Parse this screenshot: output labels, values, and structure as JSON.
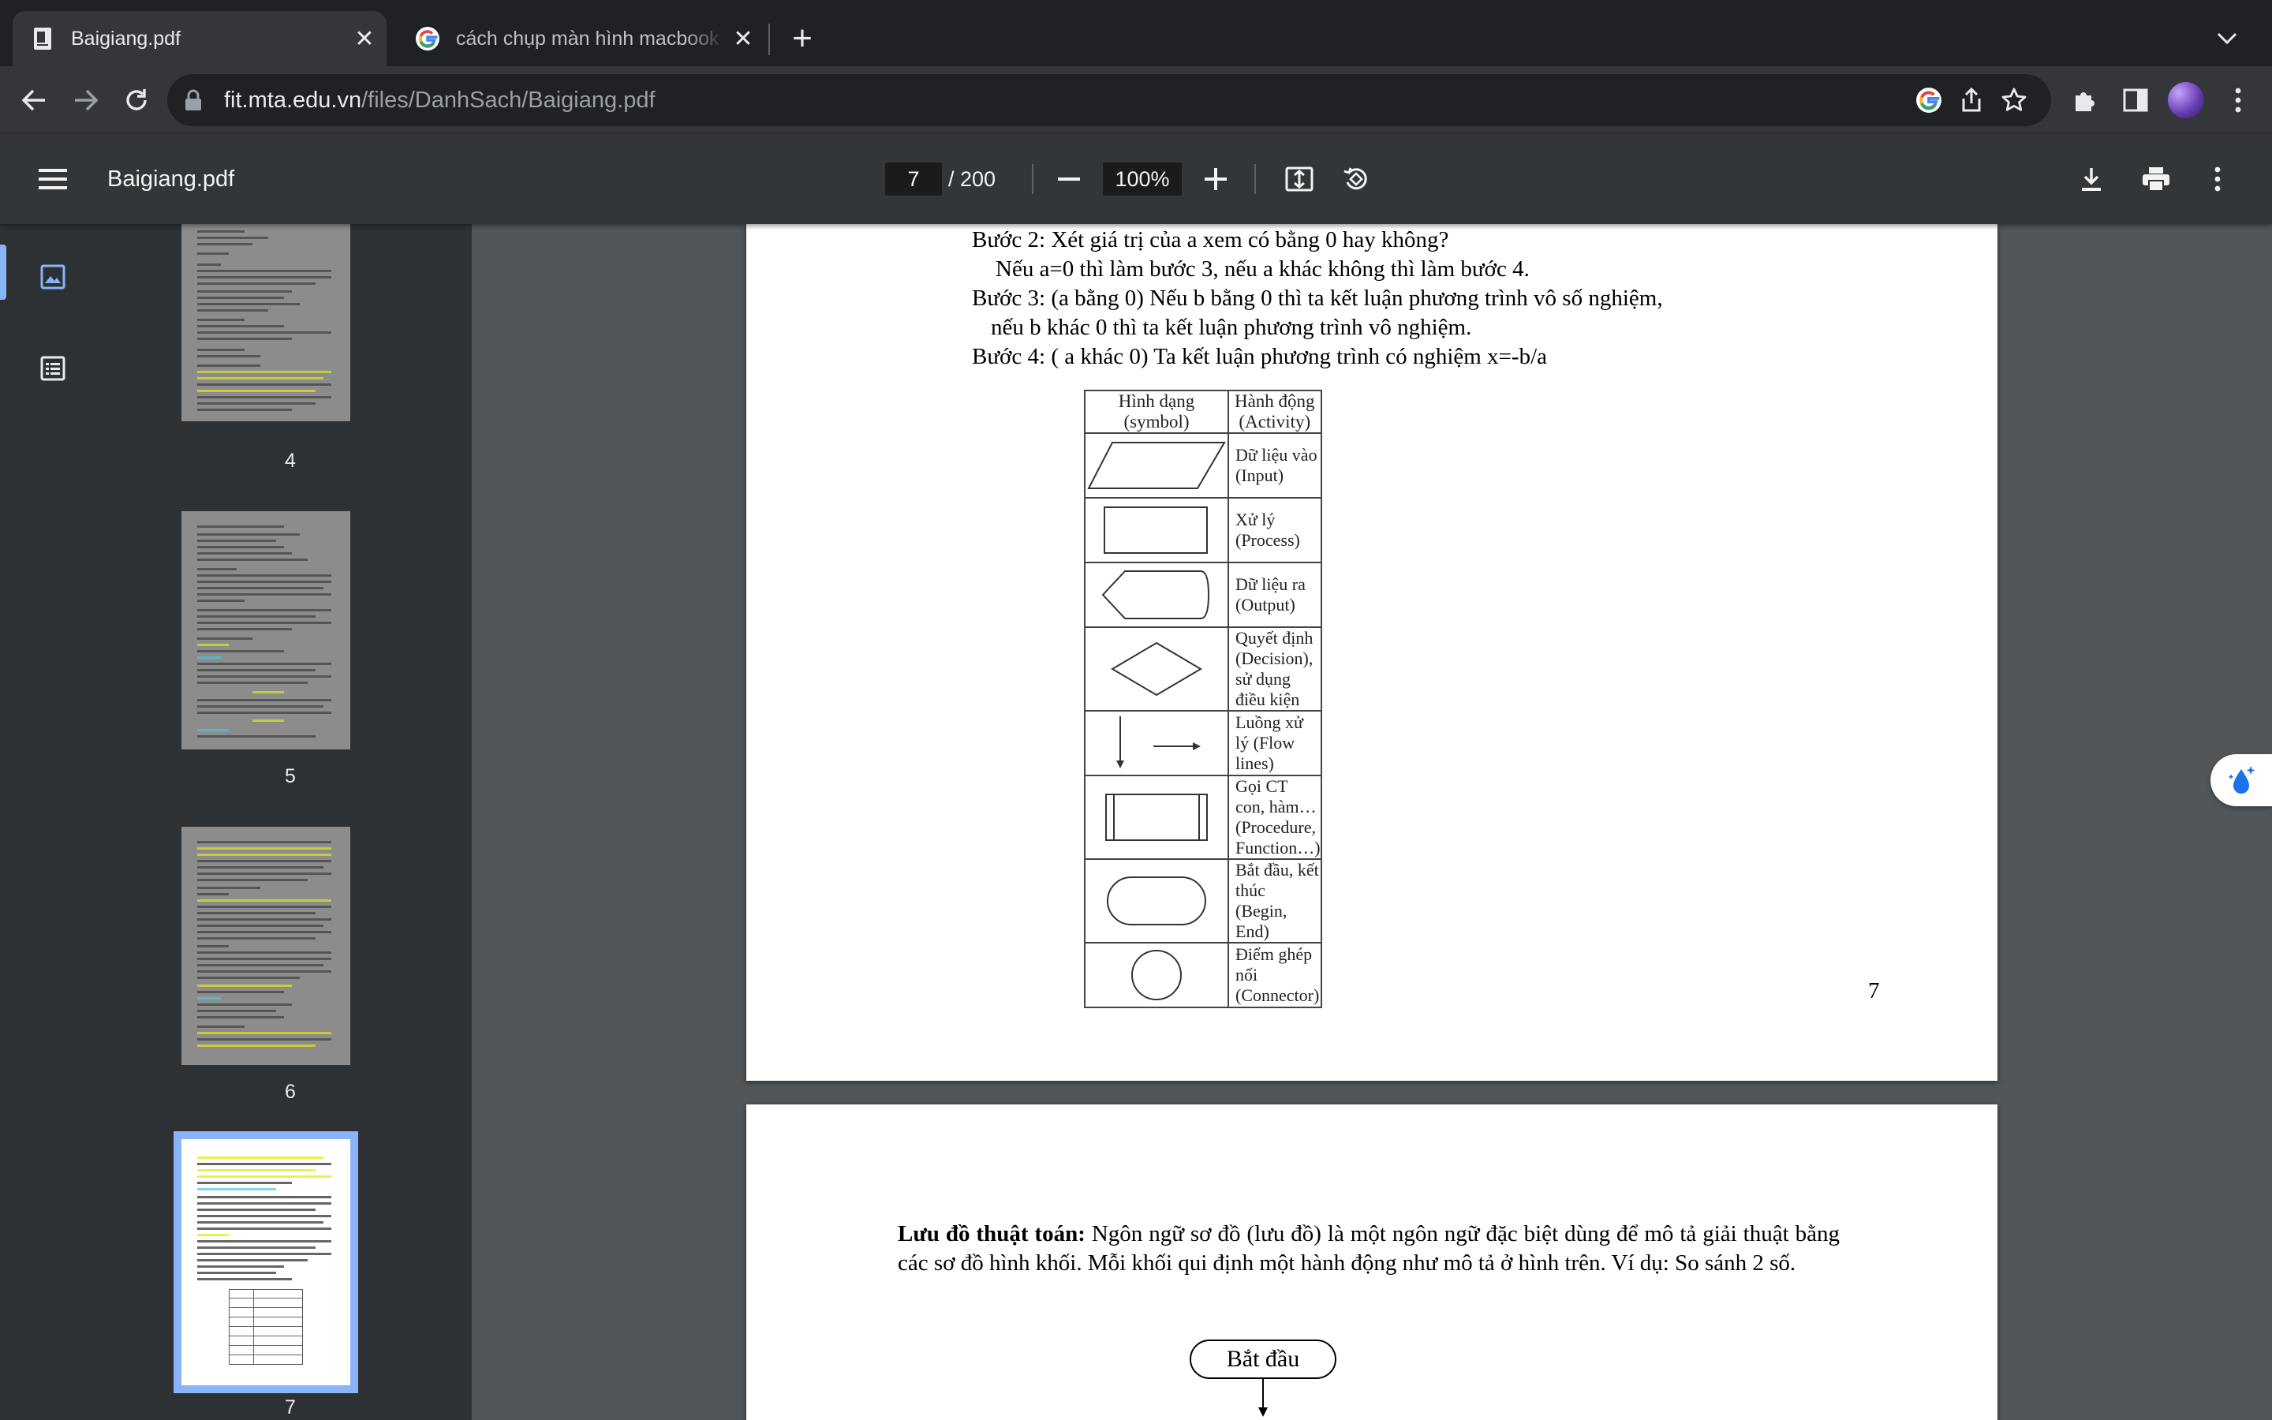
{
  "browser": {
    "tabs": [
      {
        "title": "Baigiang.pdf",
        "active": true
      },
      {
        "title": "cách chụp màn hình macbook",
        "active": false
      }
    ],
    "url": {
      "host": "fit.mta.edu.vn",
      "path": "/files/DanhSach/Baigiang.pdf"
    }
  },
  "viewer": {
    "title": "Baigiang.pdf",
    "current_page": "7",
    "total_pages": "/ 200",
    "zoom": "100%"
  },
  "sidebar": {
    "thumbnails": [
      {
        "label": "4"
      },
      {
        "label": "5"
      },
      {
        "label": "6"
      },
      {
        "label": "7",
        "selected": true
      }
    ]
  },
  "document": {
    "steps": [
      "Bước 2: Xét giá trị của a xem có bằng 0 hay không?",
      "Nếu a=0 thì làm bước 3, nếu a khác không thì làm bước 4.",
      "Bước 3: (a bằng 0) Nếu b bằng 0 thì ta kết luận phương trình vô số nghiệm,",
      "nếu b khác 0 thì ta kết luận phương trình vô nghiệm.",
      "Bước 4: ( a khác 0) Ta kết luận phương trình có nghiệm x=-b/a"
    ],
    "table": {
      "headers": [
        "Hình dạng (symbol)",
        "Hành động (Activity)"
      ],
      "rows": [
        {
          "symbol": "parallelogram",
          "activity": "Dữ liệu vào (Input)"
        },
        {
          "symbol": "rectangle",
          "activity": "Xử lý (Process)"
        },
        {
          "symbol": "display",
          "activity": "Dữ liệu ra (Output)"
        },
        {
          "symbol": "diamond",
          "activity": "Quyết định (Decision), sử dụng điều kiện"
        },
        {
          "symbol": "arrows",
          "activity": "Luồng xử lý (Flow lines)"
        },
        {
          "symbol": "subroutine",
          "activity": "Gọi CT con, hàm… (Procedure, Function…)"
        },
        {
          "symbol": "terminator",
          "activity": "Bắt đầu, kết thúc (Begin, End)"
        },
        {
          "symbol": "circle",
          "activity": "Điểm ghép nối (Connector)"
        }
      ]
    },
    "page_number": "7",
    "next_page": {
      "para_bold": "Lưu đồ thuật toán:",
      "para_rest": " Ngôn ngữ sơ đồ (lưu đồ) là một ngôn ngữ đặc biệt dùng để mô tả giải thuật bằng các sơ đồ hình khối. Mỗi khối qui định một hành động như mô tả ở hình trên. Ví dụ: So sánh 2 số.",
      "start_node": "Bắt đầu"
    }
  }
}
